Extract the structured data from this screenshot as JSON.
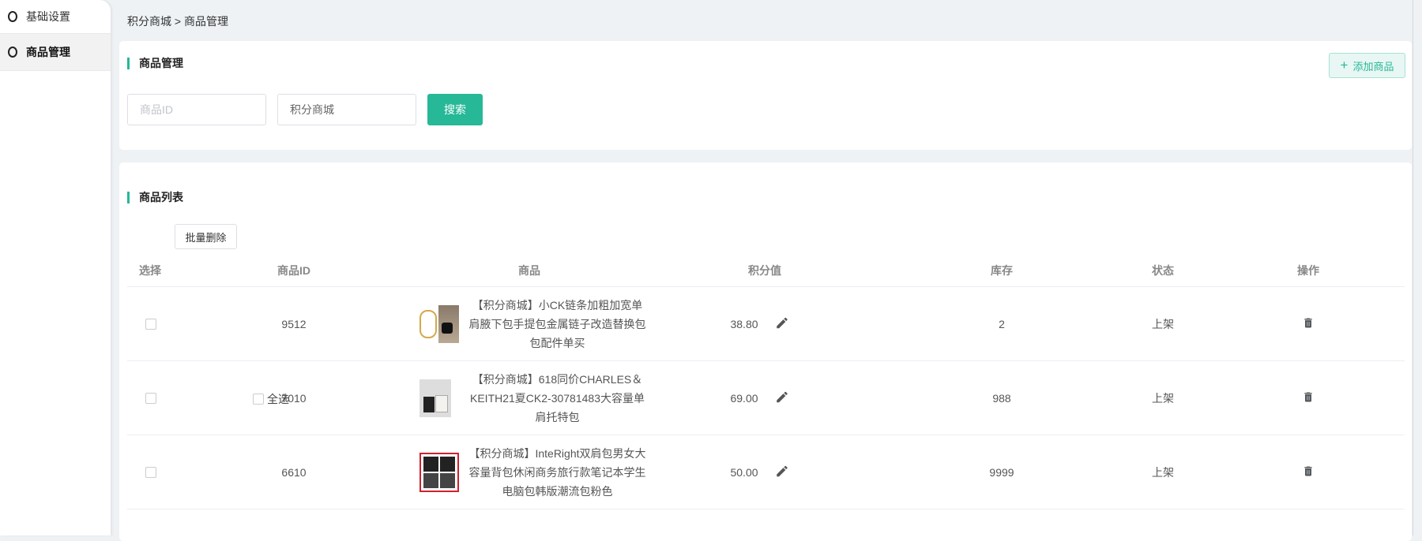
{
  "sidebar": {
    "items": [
      {
        "label": "基础设置"
      },
      {
        "label": "商品管理"
      }
    ]
  },
  "breadcrumb": "积分商城 > 商品管理",
  "manage": {
    "title": "商品管理",
    "add_button": "添加商品",
    "id_placeholder": "商品ID",
    "shop_value": "积分商城",
    "search_button": "搜索"
  },
  "list": {
    "title": "商品列表",
    "select_all": "全选",
    "bulk_delete": "批量删除",
    "columns": [
      "选择",
      "商品ID",
      "商品",
      "积分值",
      "库存",
      "状态",
      "操作"
    ],
    "rows": [
      {
        "id": "9512",
        "title": "【积分商城】小CK链条加粗加宽单肩腋下包手提包金属链子改造替换包包配件单买",
        "points": "38.80",
        "stock": "2",
        "status": "上架"
      },
      {
        "id": "7010",
        "title": "【积分商城】618同价CHARLES＆KEITH21夏CK2-30781483大容量单肩托特包",
        "points": "69.00",
        "stock": "988",
        "status": "上架"
      },
      {
        "id": "6610",
        "title": "【积分商城】InteRight双肩包男女大容量背包休闲商务旅行款笔记本学生电脑包韩版潮流包粉色",
        "points": "50.00",
        "stock": "9999",
        "status": "上架"
      }
    ]
  },
  "colors": {
    "accent": "#27b898"
  }
}
